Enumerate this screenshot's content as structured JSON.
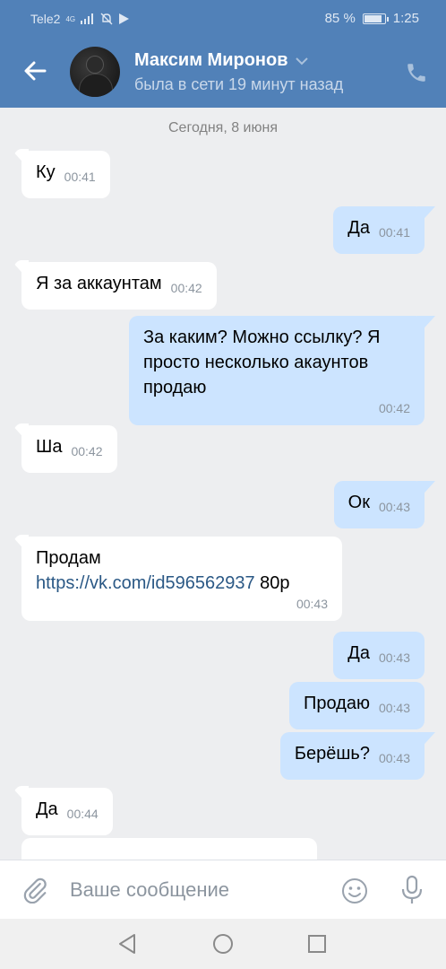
{
  "status_bar": {
    "carrier": "Tele2",
    "network": "4G",
    "battery": "85 %",
    "battery_level": 0.85,
    "time": "1:25"
  },
  "header": {
    "contact_name": "Максим Миронов",
    "contact_status": "была в сети 19 минут назад"
  },
  "chat": {
    "date_separator": "Сегодня, 8 июня",
    "messages": [
      {
        "direction": "in",
        "text": "Ку",
        "time": "00:41"
      },
      {
        "direction": "out",
        "text": "Да",
        "time": "00:41"
      },
      {
        "direction": "in",
        "text": "Я за аккаунтам",
        "time": "00:42"
      },
      {
        "direction": "out",
        "text": "За каким? Можно ссылку? Я просто несколько акаунтов продаю",
        "time": "00:42"
      },
      {
        "direction": "in",
        "text": "Ша",
        "time": "00:42"
      },
      {
        "direction": "out",
        "text": "Ок",
        "time": "00:43"
      },
      {
        "direction": "in",
        "text_prefix": "Продам",
        "link": "https://vk.com/id596562937",
        "text_suffix": " 80р",
        "time": "00:43"
      },
      {
        "direction": "out",
        "text": "Да",
        "time": "00:43"
      },
      {
        "direction": "out",
        "text": "Продаю",
        "time": "00:43"
      },
      {
        "direction": "out",
        "text": "Берёшь?",
        "time": "00:43"
      },
      {
        "direction": "in",
        "text": "Да",
        "time": "00:44"
      },
      {
        "direction": "in",
        "text": "",
        "time": ""
      }
    ]
  },
  "composer": {
    "placeholder": "Ваше сообщение"
  },
  "colors": {
    "header": "#5181b8",
    "incoming_bubble": "#ffffff",
    "outgoing_bubble": "#cce4ff",
    "link": "#2a5885",
    "chat_background": "#edeef0"
  }
}
